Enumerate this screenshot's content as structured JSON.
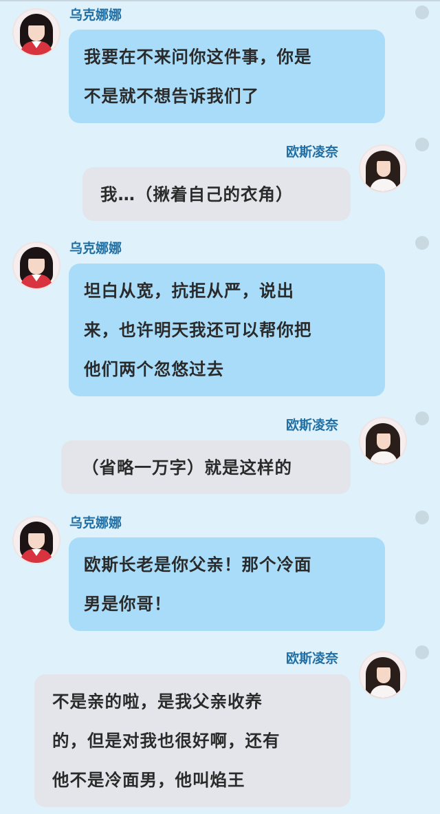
{
  "messages": [
    {
      "side": "left",
      "sender": "乌克娜娜",
      "lines": [
        "我要在不来问你这件事，你是",
        "不是就不想告诉我们了"
      ]
    },
    {
      "side": "right",
      "sender": "欧斯凌奈",
      "lines": [
        "我…（揪着自己的衣角）"
      ]
    },
    {
      "side": "left",
      "sender": "乌克娜娜",
      "lines": [
        "坦白从宽，抗拒从严，说出",
        "来，也许明天我还可以帮你把",
        "他们两个忽悠过去"
      ]
    },
    {
      "side": "right",
      "sender": "欧斯凌奈",
      "lines": [
        "（省略一万字）就是这样的"
      ]
    },
    {
      "side": "left",
      "sender": "乌克娜娜",
      "lines": [
        "欧斯长老是你父亲！那个冷面",
        "男是你哥！"
      ]
    },
    {
      "side": "right",
      "sender": "欧斯凌奈",
      "lines": [
        "不是亲的啦，是我父亲收养",
        "的，但是对我也很好啊，还有",
        "他不是冷面男，他叫焰王"
      ]
    }
  ],
  "colors": {
    "background": "#dff1fb",
    "sender_name": "#1f6ea4",
    "bubble_left": "#a9dcf8",
    "bubble_right": "#e3e5ea",
    "text": "#2a2a2a"
  }
}
